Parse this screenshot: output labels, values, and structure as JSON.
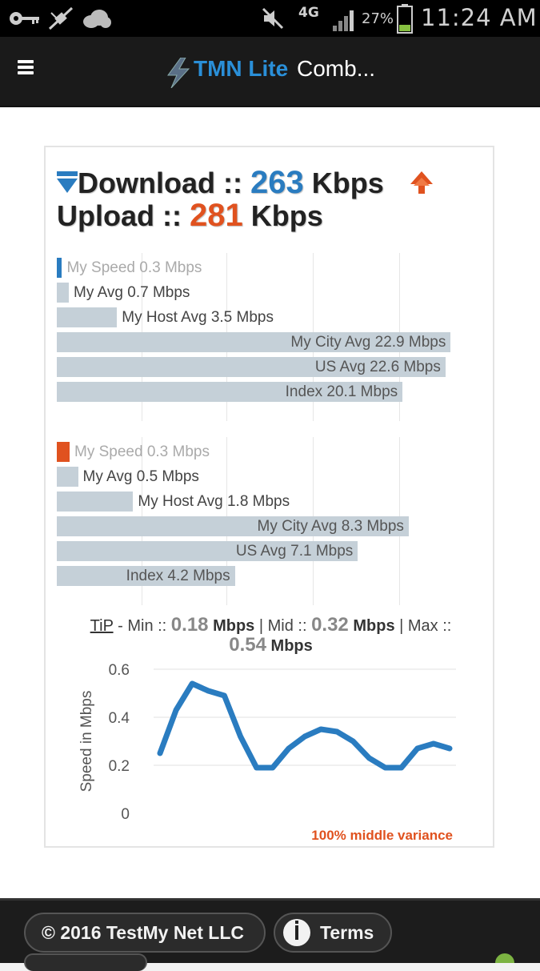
{
  "status_bar": {
    "network": "4G",
    "battery": "27%",
    "time": "11:24 AM",
    "icons": [
      "key-icon",
      "satellite-icon",
      "cloud-icon",
      "mute-icon",
      "signal-icon",
      "battery-icon"
    ]
  },
  "app_bar": {
    "brand": "TMN Lite",
    "subtitle": "Comb...",
    "icons": [
      "menu-icon",
      "lightning-logo-icon"
    ]
  },
  "results": {
    "download_prefix": "Download ::",
    "download_value": "263",
    "download_unit": "Kbps",
    "upload_prefix": "Upload ::",
    "upload_value": "281",
    "upload_unit": "Kbps",
    "download_color": "#2a7cc0",
    "upload_color": "#e0521f"
  },
  "download_bars": [
    {
      "label": "My Speed 0.3 Mbps",
      "value": 0.3
    },
    {
      "label": "My Avg 0.7 Mbps",
      "value": 0.7
    },
    {
      "label": "My Host Avg 3.5 Mbps",
      "value": 3.5
    },
    {
      "label": "My City Avg 22.9 Mbps",
      "value": 22.9
    },
    {
      "label": "US Avg 22.6 Mbps",
      "value": 22.6
    },
    {
      "label": "Index 20.1 Mbps",
      "value": 20.1
    }
  ],
  "upload_bars": [
    {
      "label": "My Speed 0.3 Mbps",
      "value": 0.3
    },
    {
      "label": "My Avg 0.5 Mbps",
      "value": 0.5
    },
    {
      "label": "My Host Avg 1.8 Mbps",
      "value": 1.8
    },
    {
      "label": "My City Avg 8.3 Mbps",
      "value": 8.3
    },
    {
      "label": "US Avg 7.1 Mbps",
      "value": 7.1
    },
    {
      "label": "Index 4.2 Mbps",
      "value": 4.2
    }
  ],
  "tip": {
    "link": "TiP",
    "min_label": " - Min :: ",
    "min_value": "0.18",
    "mid_label": " | Mid :: ",
    "mid_value": "0.32",
    "max_label": " | Max :: ",
    "max_value": "0.54",
    "unit": "Mbps"
  },
  "chart_data": {
    "type": "line",
    "ylabel": "Speed in Mbps",
    "yticks": [
      "0.6",
      "0.4",
      "0.2",
      "0"
    ],
    "ylim": [
      0,
      0.6
    ],
    "values": [
      0.25,
      0.43,
      0.54,
      0.51,
      0.49,
      0.32,
      0.19,
      0.19,
      0.27,
      0.32,
      0.35,
      0.34,
      0.3,
      0.23,
      0.19,
      0.19,
      0.27,
      0.29,
      0.27
    ],
    "grid": true,
    "note": "100% middle variance"
  },
  "footer": {
    "copyright": "© 2016 TestMy Net LLC",
    "terms": "Terms",
    "icons": [
      "info-icon",
      "android-icon"
    ]
  }
}
